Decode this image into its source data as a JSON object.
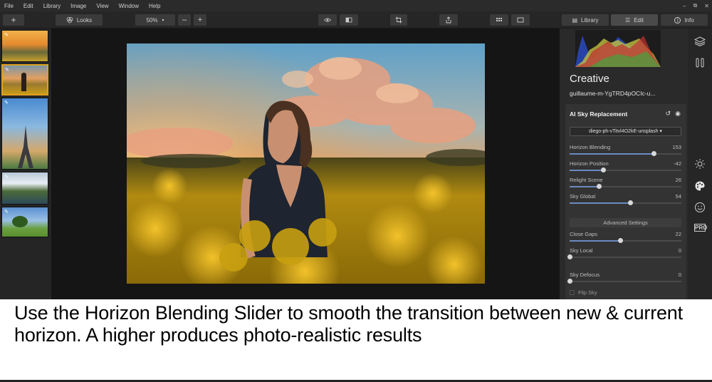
{
  "menu": [
    "File",
    "Edit",
    "Library",
    "Image",
    "View",
    "Window",
    "Help"
  ],
  "window_controls": [
    "–",
    "⧉",
    "✕"
  ],
  "toolbar": {
    "add_label": "+",
    "looks_label": "Looks",
    "zoom_value": "50%",
    "zoom_minus": "–",
    "zoom_plus": "+"
  },
  "mode_tabs": [
    {
      "label": "Library",
      "icon": "library-icon"
    },
    {
      "label": "Edit",
      "icon": "sliders-icon"
    },
    {
      "label": "Info",
      "icon": "info-icon"
    }
  ],
  "panel": {
    "title": "Creative",
    "filename": "guillaume-m-YgTRD4pOCIc-u...",
    "tool_name": "AI Sky Replacement",
    "sky_select": "diego-ph-vTitvl4O2kE-unsplash ▾",
    "advanced_label": "Advanced Settings",
    "flip_label": "Flip Sky"
  },
  "sliders": [
    {
      "label": "Horizon Blending",
      "value": "153",
      "level": 0.75
    },
    {
      "label": "Horizon Position",
      "value": "-42",
      "level": 0.3
    },
    {
      "label": "Relight Scene",
      "value": "26",
      "level": 0.26
    },
    {
      "label": "Sky Global",
      "value": "54",
      "level": 0.54
    }
  ],
  "advanced_sliders": [
    {
      "label": "Close Gaps",
      "value": "22",
      "level": 0.45
    },
    {
      "label": "Sky Local",
      "value": "0",
      "level": 0.0
    },
    {
      "label": "Sky Defocus",
      "value": "0",
      "level": 0.0
    }
  ],
  "sidebar_icons": [
    "layers-icon",
    "compare-icon",
    "sun-icon",
    "palette-icon",
    "smiley-icon",
    "pro-icon"
  ],
  "sidebar_pro_label": "PRO",
  "caption": "Use the Horizon Blending Slider to smooth the transition between new & current horizon. A higher produces photo-realistic results",
  "colors": {
    "accent": "#6a8ac0",
    "selection": "#e0a020"
  }
}
